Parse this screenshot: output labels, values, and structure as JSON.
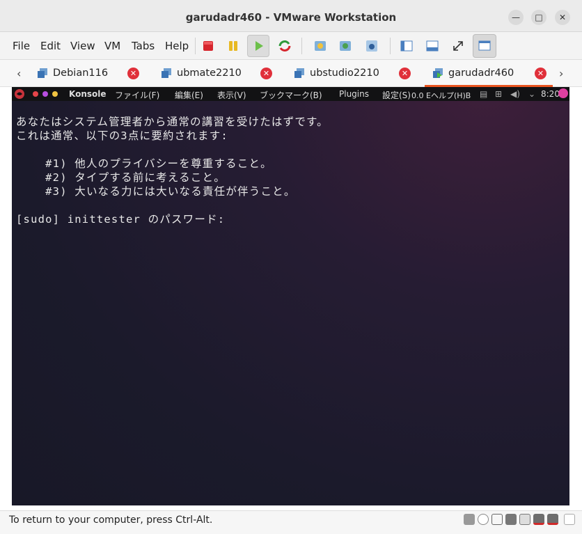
{
  "window": {
    "title": "garudadr460 - VMware Workstation"
  },
  "menu": [
    "File",
    "Edit",
    "View",
    "VM",
    "Tabs",
    "Help"
  ],
  "toolbar_icons": [
    "power-off-icon",
    "pause-icon",
    "play-icon",
    "restart-icon",
    "snapshot-icon",
    "revert-snapshot-icon",
    "snapshot-manager-icon",
    "sidebar-icon",
    "thumbnail-bar-icon",
    "fullscreen-icon",
    "unity-icon"
  ],
  "tabs": [
    {
      "label": "Debian116",
      "active": false
    },
    {
      "label": "ubmate2210",
      "active": false
    },
    {
      "label": "ubstudio2210",
      "active": false
    },
    {
      "label": "garudadr460",
      "active": true
    }
  ],
  "guest_panel": {
    "app": "Konsole",
    "menus": [
      "ファイル(F)",
      "編集(E)",
      "表示(V)",
      "ブックマーク(B)",
      "Plugins",
      "設定(S)"
    ],
    "overlap": "0.0 Eヘルプ(H)B",
    "time": "8:20"
  },
  "terminal_lines": [
    "あなたはシステム管理者から通常の講習を受けたはずです。",
    "これは通常、以下の3点に要約されます:",
    "",
    "    #1) 他人のプライバシーを尊重すること。",
    "    #2) タイプする前に考えること。",
    "    #3) 大いなる力には大いなる責任が伴うこと。",
    "",
    "[sudo] inittester のパスワード:"
  ],
  "status": {
    "text": "To return to your computer, press Ctrl-Alt."
  },
  "colors": {
    "accent": "#e95420",
    "close_red": "#e0303a",
    "terminal_bg": "#1b1a2b"
  }
}
